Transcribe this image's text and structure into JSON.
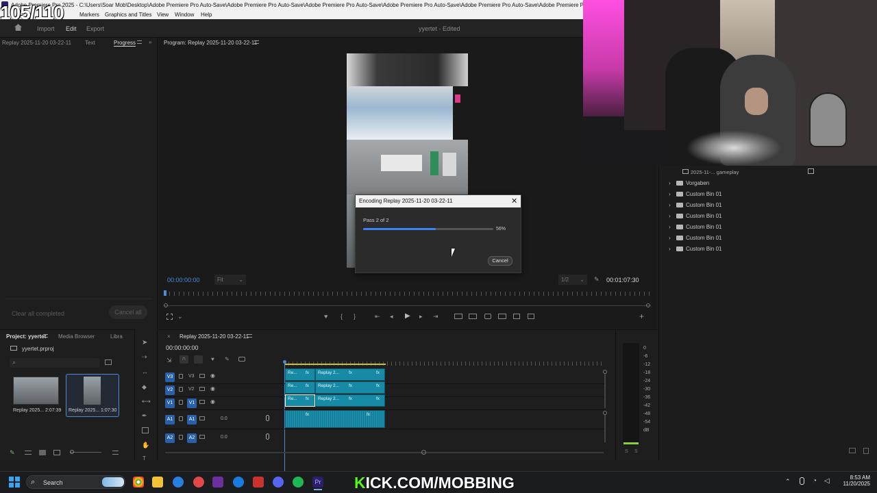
{
  "counter": "105/110",
  "window": {
    "title": "Adobe Premiere Pro 2025 - C:\\Users\\Soar Mob\\Desktop\\Adobe Premiere Pro Auto-Save\\Adobe Premiere Pro Auto-Save\\Adobe Premiere Pro Auto-Save\\Adobe Premiere Pro Auto-Save\\Adobe Premiere Pro Auto-Save\\Adobe Premiere Pro"
  },
  "menu": [
    "Markers",
    "Graphics and Titles",
    "View",
    "Window",
    "Help"
  ],
  "topnav": {
    "import": "Import",
    "edit": "Edit",
    "export": "Export",
    "project_status": "yyertet - Edited"
  },
  "left_panel": {
    "tabs": [
      "Replay 2025-11-20 03-22-11",
      "Text",
      "Progress"
    ],
    "clear_all": "Clear all completed",
    "cancel_all": "Cancel all"
  },
  "program": {
    "title": "Program: Replay 2025-11-20 03-22-11",
    "timecode_left": "00:00:00:00",
    "fit": "Fit",
    "resolution": "1/2",
    "timecode_right": "00:01:07:30"
  },
  "dialog": {
    "title": "Encoding Replay 2025-11-20 03-22-11",
    "pass": "Pass 2 of 2",
    "progress": 0.56,
    "progress_label": "56%",
    "cancel": "Cancel"
  },
  "project": {
    "tabs": [
      "Project: yyertet",
      "Media Browser",
      "Libra"
    ],
    "file": "yyertet.prproj",
    "items": [
      {
        "name": "Replay 2025...",
        "duration": "2:07:39"
      },
      {
        "name": "Replay 2025...",
        "duration": "1:07:30"
      }
    ]
  },
  "timeline": {
    "title": "Replay 2025-11-20 03-22-11",
    "timecode": "00:00:00:00",
    "video_tracks": [
      "V3",
      "V2",
      "V1"
    ],
    "audio_tracks": [
      "A1",
      "A2"
    ],
    "audio_values": [
      "0.0",
      "0.0"
    ],
    "clip_labels": [
      "Re...",
      "Replay 2...",
      "fx"
    ]
  },
  "meter_labels": [
    "0",
    "-6",
    "-12",
    "-18",
    "-24",
    "-30",
    "-36",
    "-42",
    "-48",
    "-54",
    "dB"
  ],
  "right_panel": {
    "header": "2025-11-... gameplay",
    "bins": [
      "Vorgaben",
      "Custom Bin 01",
      "Custom Bin 01",
      "Custom Bin 01",
      "Custom Bin 01",
      "Custom Bin 01",
      "Custom Bin 01"
    ]
  },
  "taskbar": {
    "search": "Search",
    "banner": "KICK.COM/MOBBING",
    "time": "8:53 AM",
    "date": "11/20/2025"
  }
}
